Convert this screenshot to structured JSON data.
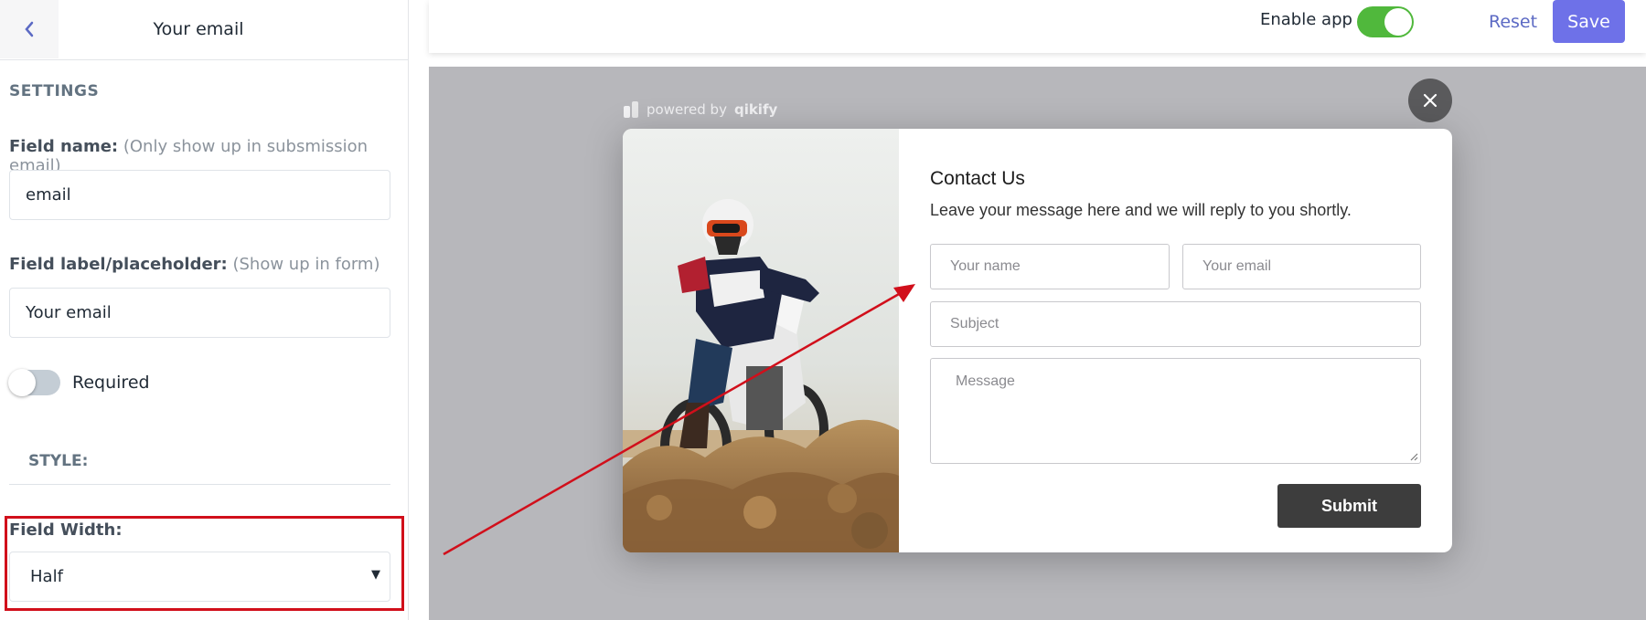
{
  "sidebar": {
    "title": "Your email",
    "settings_heading": "SETTINGS",
    "field_name": {
      "label": "Field name:",
      "hint": "(Only show up in subsmission email)",
      "value": "email"
    },
    "field_label": {
      "label": "Field label/placeholder:",
      "hint": "(Show up in form)",
      "value": "Your email"
    },
    "required": {
      "label": "Required",
      "enabled": false
    },
    "style_heading": "STYLE:",
    "field_width": {
      "label": "Field Width:",
      "selected": "Half"
    }
  },
  "topbar": {
    "enable_label": "Enable app",
    "enable_on": true,
    "reset_label": "Reset",
    "save_label": "Save"
  },
  "preview": {
    "powered_prefix": "powered by",
    "powered_brand": "qikify",
    "contact_title": "Contact Us",
    "contact_subtitle": "Leave your message here and we will reply to you shortly.",
    "name_placeholder": "Your name",
    "email_placeholder": "Your email",
    "subject_placeholder": "Subject",
    "message_placeholder": "Message",
    "submit_label": "Submit"
  },
  "colors": {
    "accent": "#6e71e8",
    "toggle_on": "#50b83c",
    "highlight": "#d10f1b"
  },
  "icons": [
    "chevron-left-icon",
    "close-icon",
    "qikify-logo-icon",
    "dropdown-caret-icon",
    "resize-grip-icon"
  ]
}
